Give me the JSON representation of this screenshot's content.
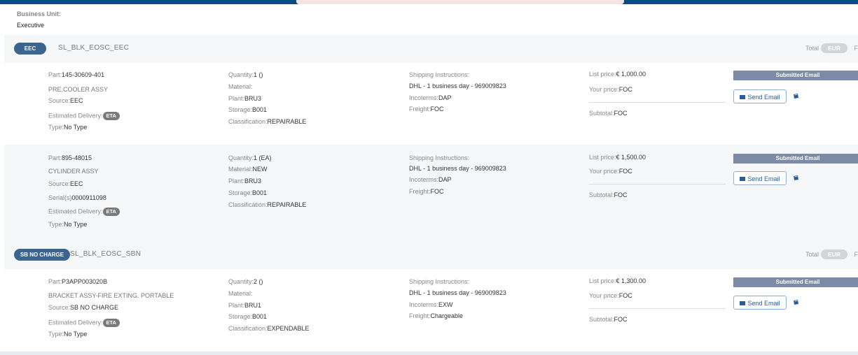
{
  "business_unit": {
    "label": "Business Unit:",
    "value": "Executive"
  },
  "labels": {
    "part": "Part:",
    "source": "Source:",
    "estimated_delivery": "Estimated Delivery:",
    "eta": "ETA",
    "type": "Type:",
    "serials": "Serial(s)",
    "quantity": "Quantity:",
    "material": "Material:",
    "plant": "Plant:",
    "storage": "Storage:",
    "classification": "Classification:",
    "shipping_instructions": "Shipping Instructions:",
    "incoterms": "Incoterms:",
    "freight": "Freight:",
    "list_price": "List price:",
    "your_price": "Your price:",
    "subtotal": "Subtotal:",
    "submitted_email": "Submitted Email",
    "send_email": "Send Email",
    "total": "Total",
    "f_cut": "F"
  },
  "groups": [
    {
      "pill": "EEC",
      "code": "SL_BLK_EOSC_EEC",
      "currency": "EUR"
    },
    {
      "pill": "SB NO CHARGE",
      "code": "SL_BLK_EOSC_SBN",
      "currency": "EUR"
    }
  ],
  "items": [
    {
      "part": "145-30609-401",
      "description": "PRE,COOLER ASSY",
      "source": "EEC",
      "serial": "",
      "type": "No Type",
      "quantity": "1 ()",
      "material": "",
      "plant": "BRU3",
      "storage": "B001",
      "classification": "REPAIRABLE",
      "shipping": "DHL - 1 business day - 969009823",
      "incoterms": "DAP",
      "freight": "FOC",
      "list_price": "€ 1,000.00",
      "your_price": "FOC",
      "subtotal": "FOC"
    },
    {
      "part": "895-48015",
      "description": "CYLINDER ASSY",
      "source": "EEC",
      "serial": "0000911098",
      "type": "No Type",
      "quantity": "1 (EA)",
      "material": "NEW",
      "plant": "BRU3",
      "storage": "B001",
      "classification": "REPAIRABLE",
      "shipping": "DHL - 1 business day - 969009823",
      "incoterms": "DAP",
      "freight": "FOC",
      "list_price": "€ 1,500.00",
      "your_price": "FOC",
      "subtotal": "FOC"
    },
    {
      "part": "P3APP003020B",
      "description": "BRACKET ASSY-FIRE EXTING. PORTABLE",
      "source": "SB NO CHARGE",
      "serial": "",
      "type": "No Type",
      "quantity": "2 ()",
      "material": "",
      "plant": "BRU1",
      "storage": "B001",
      "classification": "EXPENDABLE",
      "shipping": "DHL - 1 business day - 969009823",
      "incoterms": "EXW",
      "freight": "Chargeable",
      "list_price": "€ 1,300.00",
      "your_price": "FOC",
      "subtotal": "FOC"
    }
  ]
}
